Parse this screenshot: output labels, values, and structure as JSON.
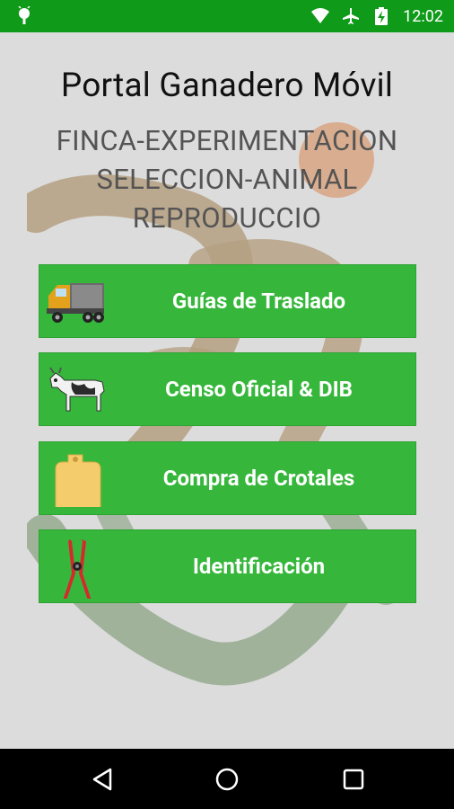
{
  "status_bar": {
    "time": "12:02",
    "icons": [
      "android-icon",
      "wifi-icon",
      "airplane-icon",
      "battery-charging-icon"
    ]
  },
  "header": {
    "title": "Portal Ganadero Móvil",
    "subtitle_lines": [
      "FINCA-EXPERIMENTACION",
      "SELECCION-ANIMAL",
      "REPRODUCCIO"
    ]
  },
  "menu": {
    "items": [
      {
        "label": "Guías de Traslado",
        "icon": "truck-icon"
      },
      {
        "label": "Censo Oficial & DIB",
        "icon": "cow-icon"
      },
      {
        "label": "Compra de Crotales",
        "icon": "ear-tag-icon"
      },
      {
        "label": "Identificación",
        "icon": "tag-applicator-icon"
      }
    ]
  },
  "navbar": {
    "icons": [
      "back-icon",
      "home-icon",
      "recents-icon"
    ]
  },
  "colors": {
    "status_bar": "#0f9a19",
    "button": "#36b73b",
    "background": "#dcdcdc",
    "watermark_brown": "#b39c7c",
    "watermark_green": "#8fa587",
    "sun": "#d9a584"
  }
}
